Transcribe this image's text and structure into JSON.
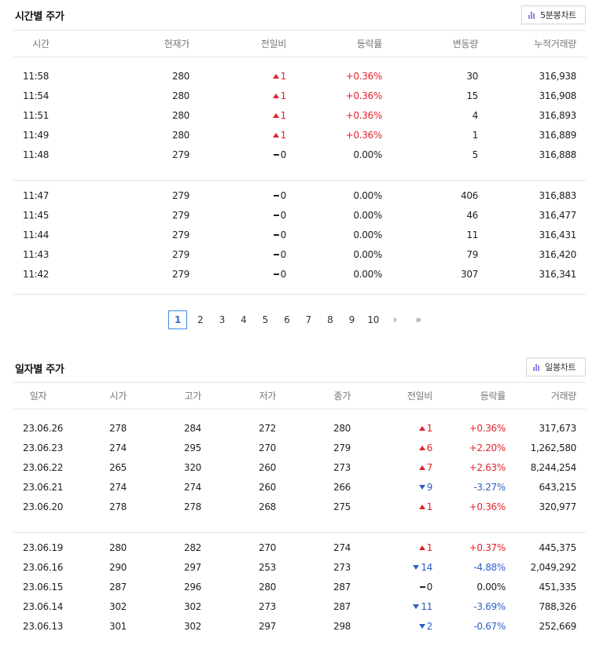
{
  "intraday": {
    "title": "시간별 주가",
    "chart_button": "5분봉차트",
    "headers": [
      "시간",
      "현재가",
      "전일비",
      "등락률",
      "변동량",
      "누적거래량"
    ],
    "groups": [
      [
        {
          "time": "11:58",
          "price": "280",
          "dir": "up",
          "change": "1",
          "rate": "+0.36%",
          "vol": "30",
          "cum": "316,938"
        },
        {
          "time": "11:54",
          "price": "280",
          "dir": "up",
          "change": "1",
          "rate": "+0.36%",
          "vol": "15",
          "cum": "316,908"
        },
        {
          "time": "11:51",
          "price": "280",
          "dir": "up",
          "change": "1",
          "rate": "+0.36%",
          "vol": "4",
          "cum": "316,893"
        },
        {
          "time": "11:49",
          "price": "280",
          "dir": "up",
          "change": "1",
          "rate": "+0.36%",
          "vol": "1",
          "cum": "316,889"
        },
        {
          "time": "11:48",
          "price": "279",
          "dir": "flat",
          "change": "0",
          "rate": "0.00%",
          "vol": "5",
          "cum": "316,888"
        }
      ],
      [
        {
          "time": "11:47",
          "price": "279",
          "dir": "flat",
          "change": "0",
          "rate": "0.00%",
          "vol": "406",
          "cum": "316,883"
        },
        {
          "time": "11:45",
          "price": "279",
          "dir": "flat",
          "change": "0",
          "rate": "0.00%",
          "vol": "46",
          "cum": "316,477"
        },
        {
          "time": "11:44",
          "price": "279",
          "dir": "flat",
          "change": "0",
          "rate": "0.00%",
          "vol": "11",
          "cum": "316,431"
        },
        {
          "time": "11:43",
          "price": "279",
          "dir": "flat",
          "change": "0",
          "rate": "0.00%",
          "vol": "79",
          "cum": "316,420"
        },
        {
          "time": "11:42",
          "price": "279",
          "dir": "flat",
          "change": "0",
          "rate": "0.00%",
          "vol": "307",
          "cum": "316,341"
        }
      ]
    ]
  },
  "pagination": {
    "pages": [
      "1",
      "2",
      "3",
      "4",
      "5",
      "6",
      "7",
      "8",
      "9",
      "10"
    ],
    "current": "1",
    "next": "›",
    "last": "»"
  },
  "daily": {
    "title": "일자별 주가",
    "chart_button": "일봉차트",
    "headers": [
      "일자",
      "시가",
      "고가",
      "저가",
      "종가",
      "전일비",
      "등락률",
      "거래량"
    ],
    "groups": [
      [
        {
          "date": "23.06.26",
          "open": "278",
          "high": "284",
          "low": "272",
          "close": "280",
          "dir": "up",
          "change": "1",
          "rate": "+0.36%",
          "vol": "317,673"
        },
        {
          "date": "23.06.23",
          "open": "274",
          "high": "295",
          "low": "270",
          "close": "279",
          "dir": "up",
          "change": "6",
          "rate": "+2.20%",
          "vol": "1,262,580"
        },
        {
          "date": "23.06.22",
          "open": "265",
          "high": "320",
          "low": "260",
          "close": "273",
          "dir": "up",
          "change": "7",
          "rate": "+2.63%",
          "vol": "8,244,254"
        },
        {
          "date": "23.06.21",
          "open": "274",
          "high": "274",
          "low": "260",
          "close": "266",
          "dir": "down",
          "change": "9",
          "rate": "-3.27%",
          "vol": "643,215"
        },
        {
          "date": "23.06.20",
          "open": "278",
          "high": "278",
          "low": "268",
          "close": "275",
          "dir": "up",
          "change": "1",
          "rate": "+0.36%",
          "vol": "320,977"
        }
      ],
      [
        {
          "date": "23.06.19",
          "open": "280",
          "high": "282",
          "low": "270",
          "close": "274",
          "dir": "up",
          "change": "1",
          "rate": "+0.37%",
          "vol": "445,375"
        },
        {
          "date": "23.06.16",
          "open": "290",
          "high": "297",
          "low": "253",
          "close": "273",
          "dir": "down",
          "change": "14",
          "rate": "-4.88%",
          "vol": "2,049,292"
        },
        {
          "date": "23.06.15",
          "open": "287",
          "high": "296",
          "low": "280",
          "close": "287",
          "dir": "flat",
          "change": "0",
          "rate": "0.00%",
          "vol": "451,335"
        },
        {
          "date": "23.06.14",
          "open": "302",
          "high": "302",
          "low": "273",
          "close": "287",
          "dir": "down",
          "change": "11",
          "rate": "-3.69%",
          "vol": "788,326"
        },
        {
          "date": "23.06.13",
          "open": "301",
          "high": "302",
          "low": "297",
          "close": "298",
          "dir": "down",
          "change": "2",
          "rate": "-0.67%",
          "vol": "252,669"
        }
      ]
    ]
  },
  "colors": {
    "up": "#e0242b",
    "down": "#2f5ec4",
    "accent": "#3b8ae0",
    "chart_icon": "#8c86e6"
  },
  "icons": {
    "chart_button": "bar-chart-icon",
    "up": "triangle-up-icon",
    "down": "triangle-down-icon",
    "flat": "dash-icon"
  }
}
